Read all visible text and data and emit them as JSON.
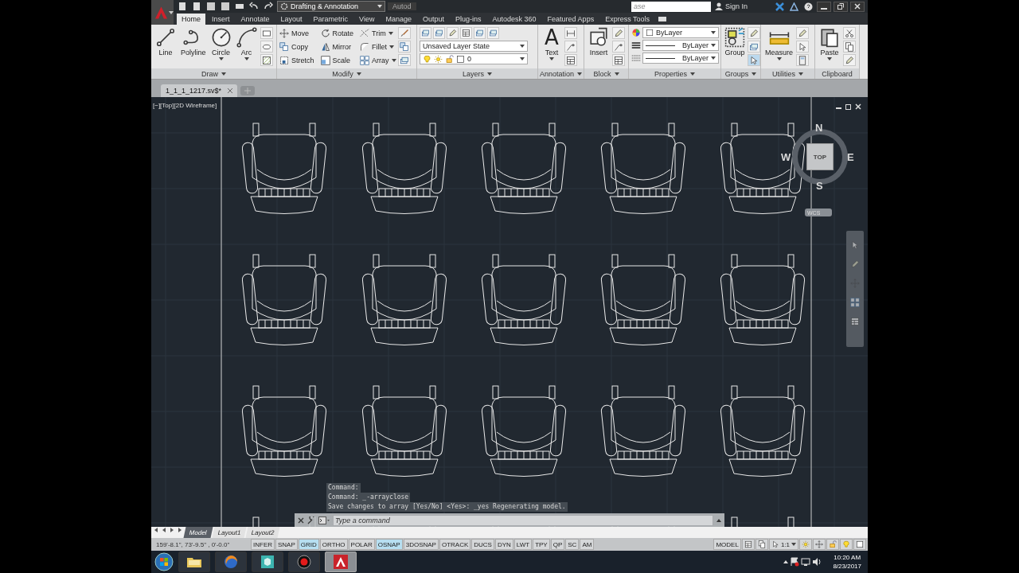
{
  "title_bar": {
    "workspace": "Drafting & Annotation",
    "title": "Autod",
    "search": {
      "placeholder": "ase"
    },
    "sign_in": "Sign In"
  },
  "tabs": [
    {
      "label": "Home",
      "selected": true
    },
    {
      "label": "Insert",
      "selected": false
    },
    {
      "label": "Annotate",
      "selected": false
    },
    {
      "label": "Layout",
      "selected": false
    },
    {
      "label": "Parametric",
      "selected": false
    },
    {
      "label": "View",
      "selected": false
    },
    {
      "label": "Manage",
      "selected": false
    },
    {
      "label": "Output",
      "selected": false
    },
    {
      "label": "Plug-ins",
      "selected": false
    },
    {
      "label": "Autodesk 360",
      "selected": false
    },
    {
      "label": "Featured Apps",
      "selected": false
    },
    {
      "label": "Express Tools",
      "selected": false
    }
  ],
  "ribbon": [
    {
      "kind": "tools",
      "title": "Draw",
      "menu": true,
      "large": [
        {
          "label": "Line",
          "dropdown": false
        },
        {
          "label": "Polyline",
          "dropdown": false
        },
        {
          "label": "Circle",
          "dropdown": true
        },
        {
          "label": "Arc",
          "dropdown": true
        }
      ]
    },
    {
      "kind": "tools",
      "title": "Modify",
      "menu": true,
      "small": [
        {
          "label": "Move",
          "dropdown": false
        },
        {
          "label": "Copy",
          "dropdown": false
        },
        {
          "label": "Stretch",
          "dropdown": false
        },
        {
          "label": "Rotate",
          "dropdown": false
        },
        {
          "label": "Mirror",
          "dropdown": false
        },
        {
          "label": "Scale",
          "dropdown": false
        },
        {
          "label": "Trim",
          "dropdown": true
        },
        {
          "label": "Fillet",
          "dropdown": true
        },
        {
          "label": "Array",
          "dropdown": true
        }
      ]
    },
    {
      "kind": "layers",
      "title": "Layers",
      "menu": true,
      "state": "Unsaved Layer State",
      "layer": "0"
    },
    {
      "kind": "tools",
      "title": "Annotation",
      "menu": true,
      "large": [
        {
          "label": "Text",
          "glyph": "A",
          "dropdown": true
        }
      ]
    },
    {
      "kind": "tools",
      "title": "Block",
      "menu": true,
      "large": [
        {
          "label": "Insert",
          "dropdown": false
        }
      ]
    },
    {
      "kind": "properties",
      "title": "Properties",
      "menu": true,
      "fields": [
        "ByLayer",
        "ByLayer",
        "ByLayer"
      ]
    },
    {
      "kind": "tools",
      "title": "Groups",
      "menu": true,
      "large": [
        {
          "label": "Group",
          "dropdown": false
        }
      ]
    },
    {
      "kind": "tools",
      "title": "Utilities",
      "menu": true,
      "large": [
        {
          "label": "Measure",
          "dropdown": true
        }
      ]
    },
    {
      "kind": "tools",
      "title": "Clipboard",
      "menu": false,
      "large": [
        {
          "label": "Paste",
          "dropdown": true
        }
      ]
    }
  ],
  "file_tabs": [
    {
      "label": "1_1_1_1217.sv$*",
      "selected": true
    }
  ],
  "viewport": {
    "label": "[−][Top][2D Wireframe]",
    "viewcube": {
      "north": "N",
      "south": "S",
      "east": "E",
      "west": "W",
      "face": "TOP",
      "ucs": "WCS"
    }
  },
  "command_line": {
    "history": [
      "Command:",
      "Command: _-arrayclose",
      "Save changes to array [Yes/No] <Yes>: _yes Regenerating model."
    ],
    "placeholder": "Type a command"
  },
  "layout_tabs": [
    {
      "label": "Model",
      "selected": true
    },
    {
      "label": "Layout1",
      "selected": false
    },
    {
      "label": "Layout2",
      "selected": false
    }
  ],
  "status_bar": {
    "coordinates": "159'-8.1\", 73'-9.5\" , 0'-0.0\"",
    "toggles": [
      {
        "label": "INFER",
        "on": false
      },
      {
        "label": "SNAP",
        "on": false
      },
      {
        "label": "GRID",
        "on": true
      },
      {
        "label": "ORTHO",
        "on": false
      },
      {
        "label": "POLAR",
        "on": false
      },
      {
        "label": "OSNAP",
        "on": true
      },
      {
        "label": "3DOSNAP",
        "on": false
      },
      {
        "label": "OTRACK",
        "on": false
      },
      {
        "label": "DUCS",
        "on": false
      },
      {
        "label": "DYN",
        "on": false
      },
      {
        "label": "LWT",
        "on": false
      },
      {
        "label": "TPY",
        "on": false
      },
      {
        "label": "QP",
        "on": false
      },
      {
        "label": "SC",
        "on": false
      },
      {
        "label": "AM",
        "on": false
      }
    ],
    "space": "MODEL",
    "scale": "1:1"
  },
  "taskbar": {
    "apps": [
      {
        "kind": "folder",
        "selected": false
      },
      {
        "kind": "browser",
        "selected": false
      },
      {
        "kind": "modeler",
        "selected": false
      },
      {
        "kind": "recorder",
        "selected": false
      },
      {
        "kind": "cad",
        "selected": true
      }
    ],
    "time": "10:20 AM",
    "date": "8/23/2017"
  }
}
